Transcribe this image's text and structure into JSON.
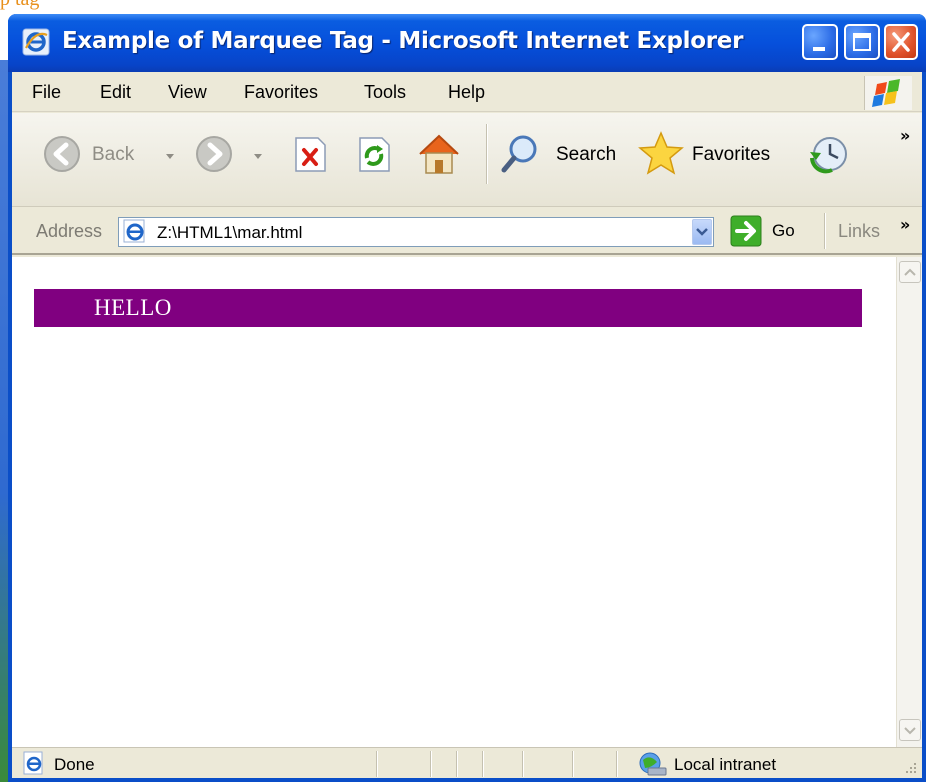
{
  "caption": {
    "partial_text": "p tag"
  },
  "window": {
    "title": "Example of Marquee Tag - Microsoft Internet Explorer",
    "buttons": {
      "minimize": "minimize-icon",
      "maximize": "maximize-icon",
      "close": "close-icon"
    }
  },
  "menu": {
    "items": [
      {
        "label": "File"
      },
      {
        "label": "Edit"
      },
      {
        "label": "View"
      },
      {
        "label": "Favorites"
      },
      {
        "label": "Tools"
      },
      {
        "label": "Help"
      }
    ]
  },
  "toolbar": {
    "back_label": "Back",
    "search_label": "Search",
    "favorites_label": "Favorites",
    "more": "»"
  },
  "address": {
    "label": "Address",
    "value": "Z:\\HTML1\\mar.html",
    "go_label": "Go",
    "links_label": "Links",
    "more": "»"
  },
  "content": {
    "marquee_text": "HELLO",
    "marquee_bg": "#800080"
  },
  "status": {
    "text": "Done",
    "zone": "Local intranet"
  },
  "colors": {
    "titlebar": "#0650dc",
    "window_border": "#0a4ec8",
    "close_button": "#e0522a"
  }
}
